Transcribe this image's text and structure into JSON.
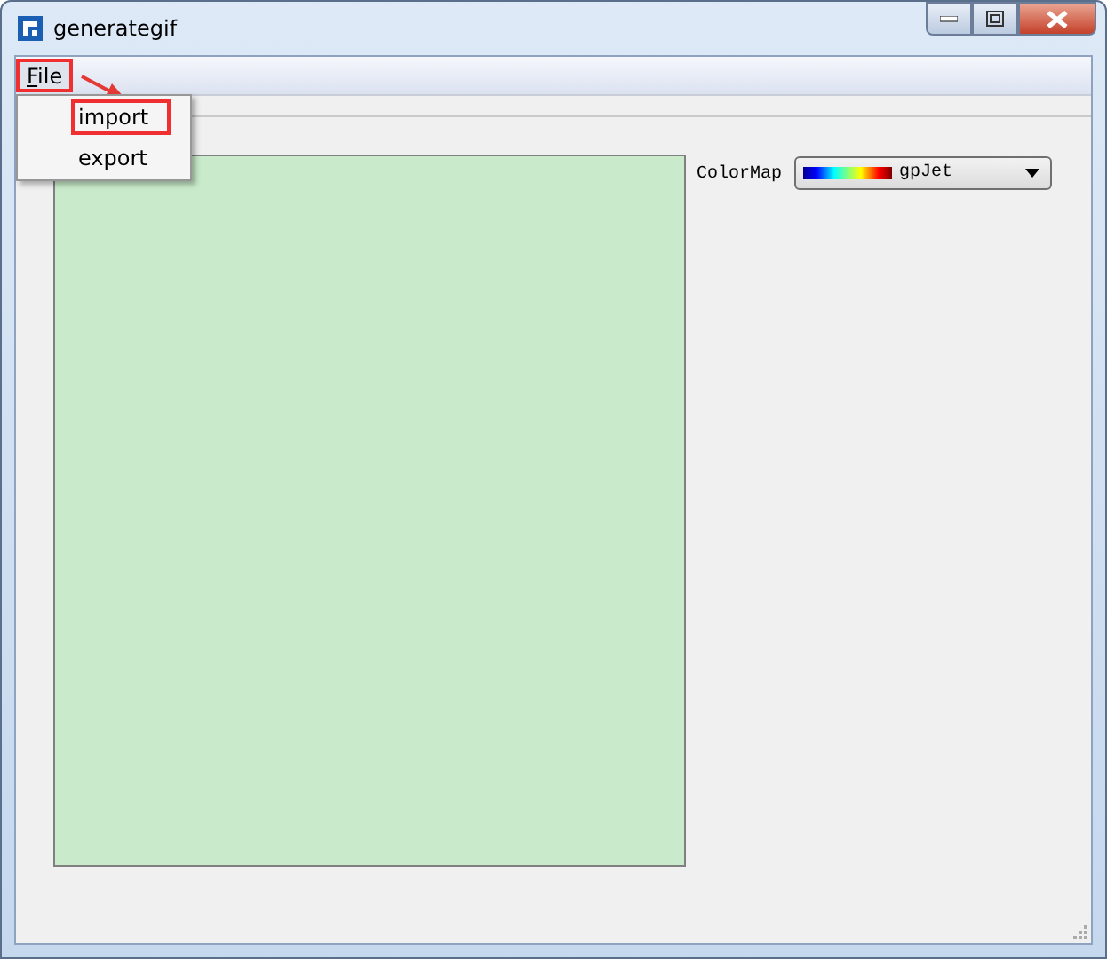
{
  "window": {
    "title": "generategif"
  },
  "menu_bar": [
    {
      "label": "File",
      "annotated": true
    }
  ],
  "open_menu": {
    "items": [
      {
        "label": "import",
        "annotated": true
      },
      {
        "label": "export",
        "annotated": false
      }
    ]
  },
  "colormap": {
    "label": "ColorMap",
    "value": "gpJet"
  }
}
